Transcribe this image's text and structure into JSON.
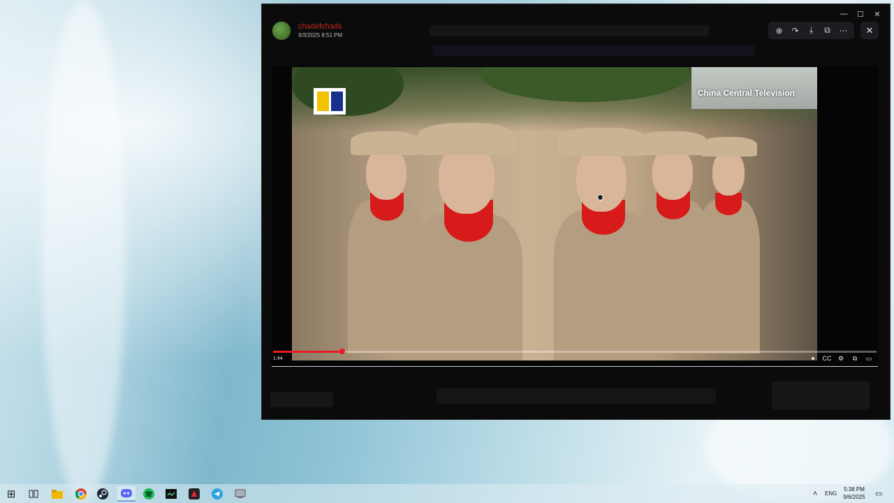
{
  "window": {
    "title": "",
    "controls": {
      "minimize": "—",
      "maximize": "☐",
      "close": "✕"
    }
  },
  "post": {
    "username": "chadefchads",
    "datetime": "9/3/2025 8:51 PM"
  },
  "toolbar": {
    "zoom": "⊕",
    "forward": "↷",
    "download": "⤓",
    "open_external": "⧉",
    "more": "⋯",
    "close": "✕"
  },
  "video": {
    "watermark": "China Central Television",
    "timecode": "1:44",
    "progress_fraction": 0.115,
    "controls": {
      "autoplay": "⏺",
      "captions": "CC",
      "settings": "⚙",
      "miniplayer": "⧉",
      "theater": "▭"
    }
  },
  "colors": {
    "accent": "#e81c24",
    "username": "#c2281f"
  },
  "taskbar": {
    "start_icon": "⊞",
    "apps": [
      "task-view",
      "file-explorer",
      "chrome",
      "steam",
      "discord",
      "spotify",
      "terminal",
      "media-app",
      "telegram",
      "network-app"
    ],
    "tray_language": "ENG",
    "tray_chevron": "˄",
    "time": "5:38 PM",
    "date": "9/6/2025",
    "notifications_icon": "▭"
  }
}
